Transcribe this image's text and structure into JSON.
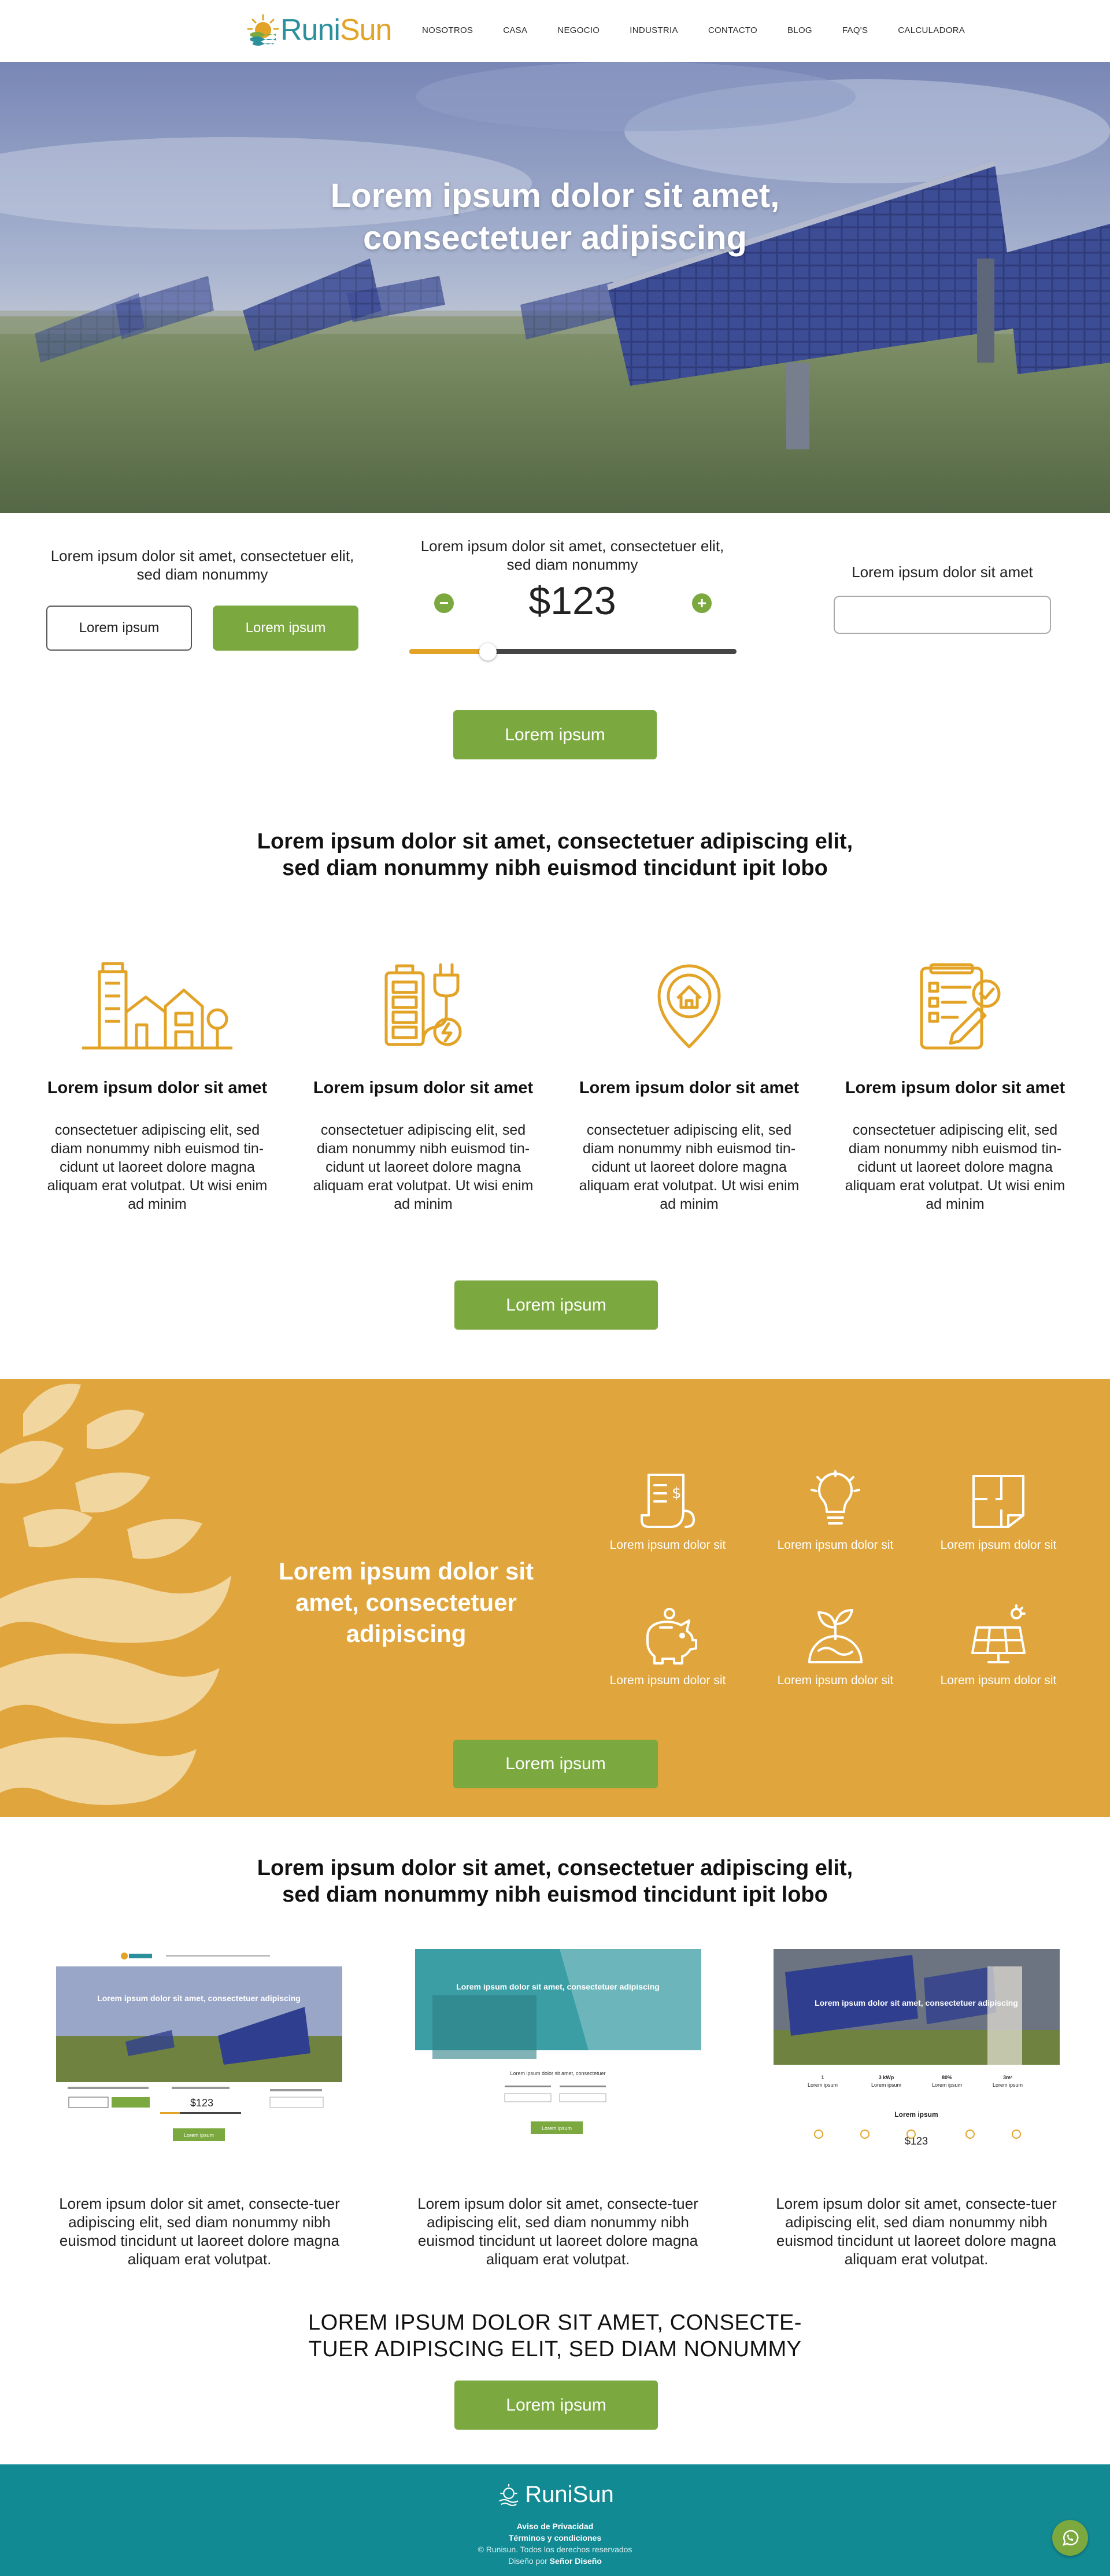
{
  "brand": {
    "name_part1": "Runi",
    "name_part2": "Sun",
    "footer_name": "RuniSun"
  },
  "nav": {
    "items": [
      "NOSOTROS",
      "CASA",
      "NEGOCIO",
      "INDUSTRIA",
      "CONTACTO",
      "BLOG",
      "FAQ'S",
      "CALCULADORA"
    ]
  },
  "hero": {
    "title_line1": "Lorem ipsum dolor sit amet,",
    "title_line2": "consectetuer adipiscing"
  },
  "calculator": {
    "left_text": "Lorem ipsum dolor sit amet, consectetuer elit, sed diam nonummy",
    "left_btn_outline": "Lorem ipsum",
    "left_btn_green": "Lorem ipsum",
    "center_text": "Lorem ipsum dolor sit amet, consectetuer elit, sed diam nonummy",
    "minus": "−",
    "plus": "+",
    "price": "$123",
    "slider_fraction": 0.24,
    "right_text": "Lorem ipsum dolor sit amet",
    "right_input_value": "",
    "cta": "Lorem ipsum"
  },
  "features": {
    "heading_line1": "Lorem ipsum dolor sit amet, consectetuer adipiscing elit,",
    "heading_line2": "sed diam nonummy nibh euismod tincidunt ipit lobo",
    "items": [
      {
        "icon": "buildings-icon",
        "title": "Lorem ipsum dolor sit amet",
        "body": "consectetuer adipiscing elit, sed diam nonummy nibh euismod tin-cidunt ut laoreet dolore magna aliquam erat volutpat. Ut wisi enim ad minim"
      },
      {
        "icon": "battery-plug-icon",
        "title": "Lorem ipsum dolor sit amet",
        "body": "consectetuer adipiscing elit, sed diam nonummy nibh euismod tin-cidunt ut laoreet dolore magna aliquam erat volutpat. Ut wisi enim ad minim"
      },
      {
        "icon": "home-location-pin-icon",
        "title": "Lorem ipsum dolor sit amet",
        "body": "consectetuer adipiscing elit, sed diam nonummy nibh euismod tin-cidunt ut laoreet dolore magna aliquam erat volutpat. Ut wisi enim ad minim"
      },
      {
        "icon": "clipboard-check-icon",
        "title": "Lorem ipsum dolor sit amet",
        "body": "consectetuer adipiscing elit, sed diam nonummy nibh euismod tin-cidunt ut laoreet dolore magna aliquam erat volutpat. Ut wisi enim ad minim"
      }
    ],
    "cta": "Lorem ipsum"
  },
  "band": {
    "title": "Lorem ipsum dolor sit amet, consectetuer adipiscing",
    "items": [
      {
        "icon": "receipt-money-icon",
        "label": "Lorem ipsum dolor sit"
      },
      {
        "icon": "lightbulb-icon",
        "label": "Lorem ipsum dolor sit"
      },
      {
        "icon": "floor-plan-icon",
        "label": "Lorem ipsum dolor sit"
      },
      {
        "icon": "piggy-bank-icon",
        "label": "Lorem ipsum dolor sit"
      },
      {
        "icon": "plant-globe-icon",
        "label": "Lorem ipsum dolor sit"
      },
      {
        "icon": "solar-panel-sun-icon",
        "label": "Lorem ipsum dolor sit"
      }
    ],
    "cta": "Lorem ipsum"
  },
  "previews": {
    "heading_line1": "Lorem ipsum dolor sit amet, consectetuer adipiscing elit,",
    "heading_line2": "sed diam nonummy nibh euismod tincidunt ipit lobo",
    "items": [
      {
        "thumb_title": "Lorem ipsum dolor sit amet, consectetuer adipiscing",
        "thumb_price": "$123",
        "thumb_button": "Lorem ipsum",
        "text": "Lorem ipsum dolor sit amet, consecte-tuer adipiscing elit, sed diam nonummy nibh euismod tincidunt ut laoreet dolore magna aliquam erat volutpat."
      },
      {
        "thumb_title": "Lorem ipsum dolor sit amet, consectetuer adipiscing",
        "thumb_caption": "Lorem ipsum dolor sit amet, consectetuer",
        "thumb_button": "Lorem ipsum",
        "text": "Lorem ipsum dolor sit amet, consecte-tuer adipiscing elit, sed diam nonummy nibh euismod tincidunt ut laoreet dolore magna aliquam erat volutpat."
      },
      {
        "thumb_title": "Lorem ipsum dolor sit amet, consectetuer adipiscing",
        "thumb_stats": [
          {
            "value": "1",
            "label": "Lorem ipsum"
          },
          {
            "value": "3 kWp",
            "label": "Lorem ipsum"
          },
          {
            "value": "80%",
            "label": "Lorem ipsum"
          },
          {
            "value": "3m²",
            "label": "Lorem ipsum"
          }
        ],
        "thumb_sub": "Lorem ipsum",
        "thumb_price": "$123",
        "text": "Lorem ipsum dolor sit amet, consecte-tuer adipiscing elit, sed diam nonummy nibh euismod tincidunt ut laoreet dolore magna aliquam erat volutpat."
      }
    ]
  },
  "closing": {
    "caps_line1": "LOREM IPSUM DOLOR SIT AMET, CONSECTE-",
    "caps_line2": "TUER ADIPISCING ELIT, SED DIAM NONUMMY",
    "cta": "Lorem ipsum"
  },
  "footer": {
    "privacy": "Aviso de Privacidad",
    "terms": "Términos y condiciones",
    "copyright": "© Runisun. Todos los derechos reservados",
    "design_prefix": "Diseño por",
    "design_by": "Señor Diseño"
  },
  "colors": {
    "green": "#7ba83f",
    "orange": "#e0a53c",
    "teal": "#128a94",
    "icon_orange": "#e2a326"
  }
}
